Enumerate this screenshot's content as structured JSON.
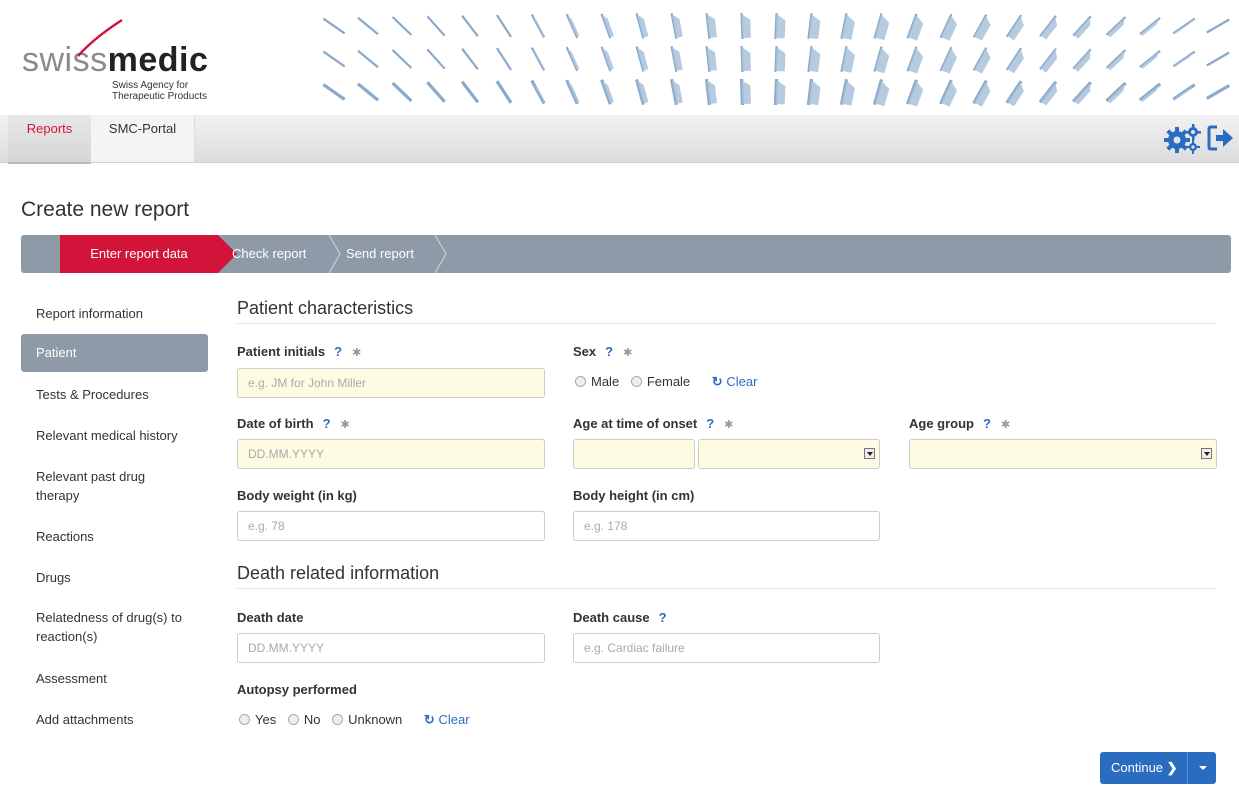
{
  "header": {
    "logo_swiss": "swiss",
    "logo_medic": "medic",
    "logo_sub_1": "Swiss Agency for",
    "logo_sub_2": "Therapeutic Products"
  },
  "nav": {
    "tabs": [
      {
        "label": "Reports",
        "active": true
      },
      {
        "label": "SMC-Portal",
        "active": false
      }
    ],
    "icons": [
      "settings-gears-icon",
      "logout-icon"
    ]
  },
  "page": {
    "title": "Create new report",
    "steps": [
      {
        "label": "Enter report data",
        "active": true
      },
      {
        "label": "Check report",
        "active": false
      },
      {
        "label": "Send report",
        "active": false
      }
    ]
  },
  "sidebar": {
    "items": [
      {
        "label": "Report information"
      },
      {
        "label": "Patient",
        "active": true
      },
      {
        "label": "Tests & Procedures"
      },
      {
        "label": "Relevant medical history"
      },
      {
        "label": "Relevant past drug therapy"
      },
      {
        "label": "Reactions"
      },
      {
        "label": "Drugs"
      },
      {
        "label": "Relatedness of drug(s) to reaction(s)"
      },
      {
        "label": "Assessment"
      },
      {
        "label": "Add attachments"
      }
    ]
  },
  "patient": {
    "section_title": "Patient characteristics",
    "initials_label": "Patient initials",
    "initials_placeholder": "e.g. JM for John Miller",
    "sex_label": "Sex",
    "sex_options": [
      "Male",
      "Female"
    ],
    "dob_label": "Date of birth",
    "dob_placeholder": "DD.MM.YYYY",
    "age_onset_label": "Age at time of onset",
    "age_group_label": "Age group",
    "weight_label": "Body weight (in kg)",
    "weight_placeholder": "e.g. 78",
    "height_label": "Body height (in cm)",
    "height_placeholder": "e.g. 178"
  },
  "death": {
    "section_title": "Death related information",
    "date_label": "Death date",
    "date_placeholder": "DD.MM.YYYY",
    "cause_label": "Death cause",
    "cause_placeholder": "e.g. Cardiac failure",
    "autopsy_label": "Autopsy performed",
    "autopsy_options": [
      "Yes",
      "No",
      "Unknown"
    ]
  },
  "common": {
    "help": "?",
    "required": "✱",
    "clear": "Clear",
    "continue": "Continue"
  },
  "colors": {
    "accent_red": "#d2143a",
    "step_bar": "#8e9aa8",
    "primary_blue": "#2a6cc0",
    "required_bg": "#fefbe3"
  }
}
